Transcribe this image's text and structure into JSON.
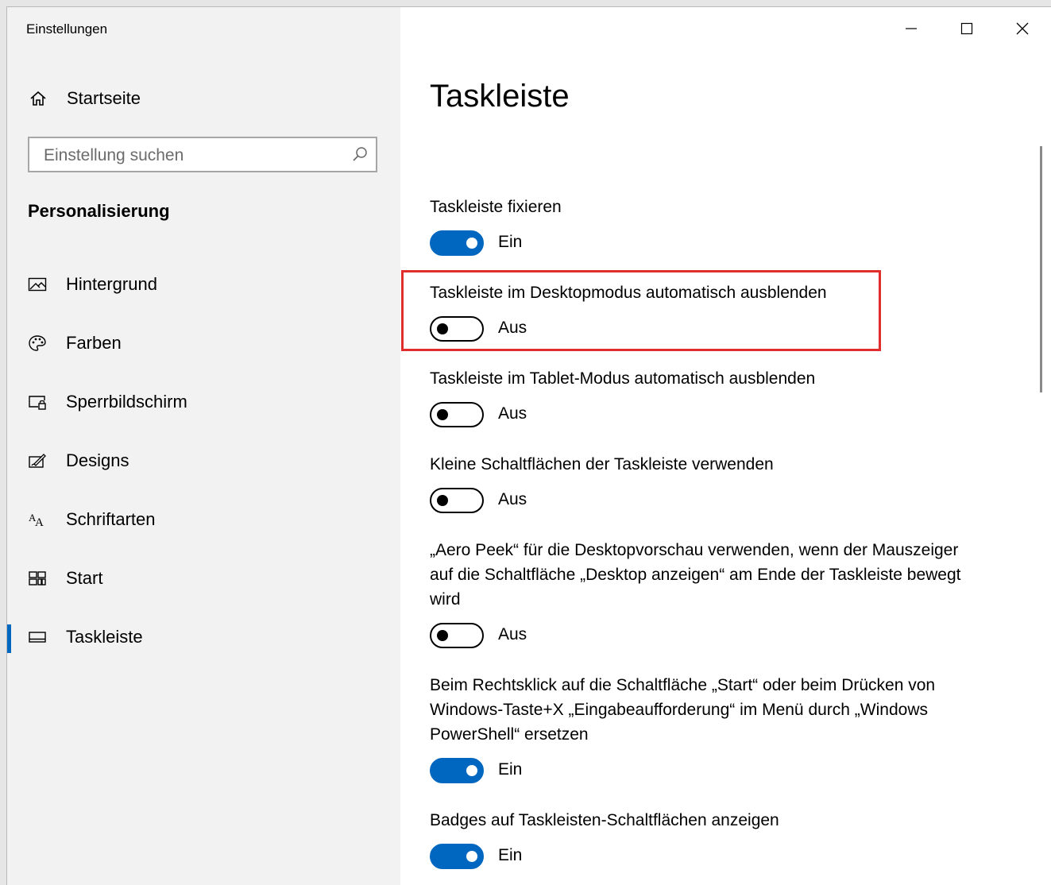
{
  "window": {
    "app_title": "Einstellungen",
    "controls": {
      "minimize": "—",
      "maximize": "☐",
      "close": "✕"
    }
  },
  "sidebar": {
    "home_label": "Startseite",
    "home_icon": "home-icon",
    "search": {
      "placeholder": "Einstellung suchen",
      "value": "",
      "icon": "search-icon"
    },
    "section": "Personalisierung",
    "items": [
      {
        "label": "Hintergrund",
        "icon": "picture-icon",
        "active": false
      },
      {
        "label": "Farben",
        "icon": "palette-icon",
        "active": false
      },
      {
        "label": "Sperrbildschirm",
        "icon": "lock-screen-icon",
        "active": false
      },
      {
        "label": "Designs",
        "icon": "brush-icon",
        "active": false
      },
      {
        "label": "Schriftarten",
        "icon": "font-icon",
        "active": false
      },
      {
        "label": "Start",
        "icon": "start-tiles-icon",
        "active": false
      },
      {
        "label": "Taskleiste",
        "icon": "taskbar-icon",
        "active": true
      }
    ]
  },
  "main": {
    "title": "Taskleiste",
    "settings": [
      {
        "title": "Taskleiste fixieren",
        "state": "Ein",
        "on": true
      },
      {
        "title": "Taskleiste im Desktopmodus automatisch ausblenden",
        "state": "Aus",
        "on": false,
        "highlighted": true
      },
      {
        "title": "Taskleiste im Tablet-Modus automatisch ausblenden",
        "state": "Aus",
        "on": false
      },
      {
        "title": "Kleine Schaltflächen der Taskleiste verwenden",
        "state": "Aus",
        "on": false
      },
      {
        "title": "„Aero Peek“ für die Desktopvorschau verwenden, wenn der Mauszeiger auf die Schaltfläche „Desktop anzeigen“ am Ende der Taskleiste bewegt wird",
        "state": "Aus",
        "on": false
      },
      {
        "title": "Beim Rechtsklick auf die Schaltfläche „Start“ oder beim Drücken von Windows-Taste+X „Eingabeaufforderung“ im Menü durch „Windows PowerShell“ ersetzen",
        "state": "Ein",
        "on": true
      },
      {
        "title": "Badges auf Taskleisten-Schaltflächen anzeigen",
        "state": "Ein",
        "on": true
      }
    ]
  },
  "colors": {
    "accent": "#0067c0",
    "highlight_border": "#e22d2d",
    "sidebar_bg": "#f2f2f2"
  }
}
